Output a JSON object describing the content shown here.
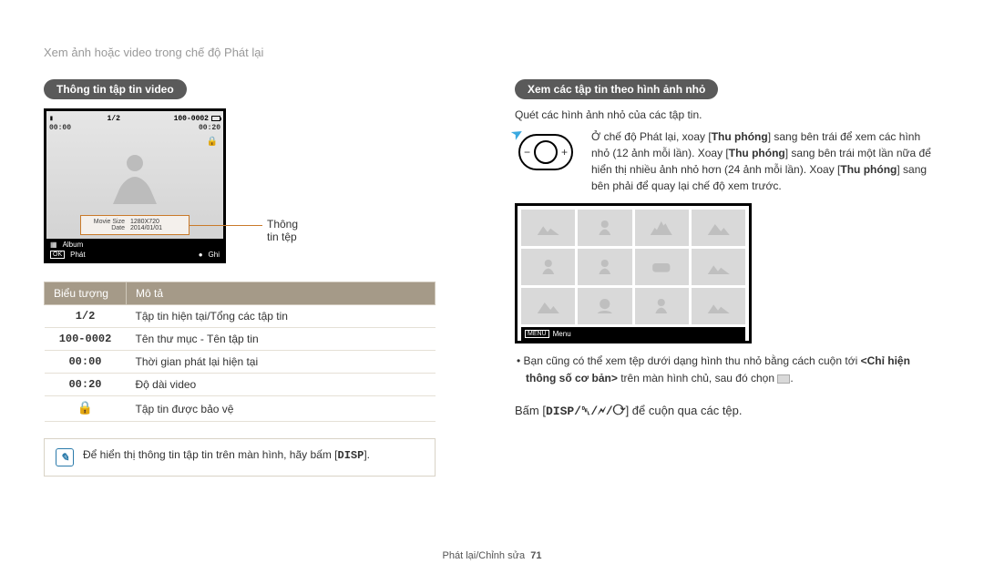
{
  "breadcrumb": "Xem ảnh hoặc video trong chế độ Phát lại",
  "left": {
    "pill": "Thông tin tập tin video",
    "lcd": {
      "counter": "1/2",
      "folder_file": "100-0002",
      "time_elapsed": "00:00",
      "duration": "00:20",
      "info_rows": [
        {
          "k": "Movie Size",
          "v": "1280X720"
        },
        {
          "k": "Date",
          "v": "2014/01/01"
        }
      ],
      "album_label": "Album",
      "ok_label": "OK",
      "play_label": "Phát",
      "rec_label": "Ghi"
    },
    "callout_label": "Thông tin tệp",
    "table": {
      "head_icon": "Biểu tượng",
      "head_desc": "Mô tả",
      "rows": [
        {
          "icon": "1/2",
          "desc": "Tập tin hiện tại/Tổng các tập tin"
        },
        {
          "icon": "100-0002",
          "desc": "Tên thư mục - Tên tập tin"
        },
        {
          "icon": "00:00",
          "desc": "Thời gian phát lại hiện tại"
        },
        {
          "icon": "00:20",
          "desc": "Độ dài video"
        },
        {
          "icon": "lock",
          "desc": "Tập tin được bảo vệ"
        }
      ]
    },
    "note_prefix": "Để hiển thị thông tin tập tin trên màn hình, hãy bấm [",
    "note_key": "DISP",
    "note_suffix": "]."
  },
  "right": {
    "pill": "Xem các tập tin theo hình ảnh nhỏ",
    "intro": "Quét các hình ảnh nhỏ của các tập tin.",
    "dial_text": {
      "p1a": "Ở chế độ Phát lại, xoay [",
      "b1": "Thu phóng",
      "p1b": "] sang bên trái để xem các hình nhỏ (12 ảnh mỗi lần). Xoay [",
      "b2": "Thu phóng",
      "p1c": "] sang bên trái một lần nữa để hiển thị nhiều ảnh nhỏ hơn (24 ảnh mỗi lần). Xoay [",
      "b3": "Thu phóng",
      "p1d": "] sang bên phải để quay lại chế độ xem trước."
    },
    "thumb_menu_key": "MENU",
    "thumb_menu_label": "Menu",
    "bullet_a": "Bạn cũng có thể xem tệp dưới dạng hình thu nhỏ bằng cách cuộn tới ",
    "bullet_b_strong": "<Chỉ hiện thông số cơ bản>",
    "bullet_c": " trên màn hình chủ, sau đó chọn ",
    "bullet_d": ".",
    "press_a": "Bấm [",
    "press_keys": "DISP/␡/🗲/⟳",
    "press_b": "] để cuộn qua các tệp."
  },
  "footer": {
    "section": "Phát lại/Chỉnh sửa",
    "page": "71"
  }
}
